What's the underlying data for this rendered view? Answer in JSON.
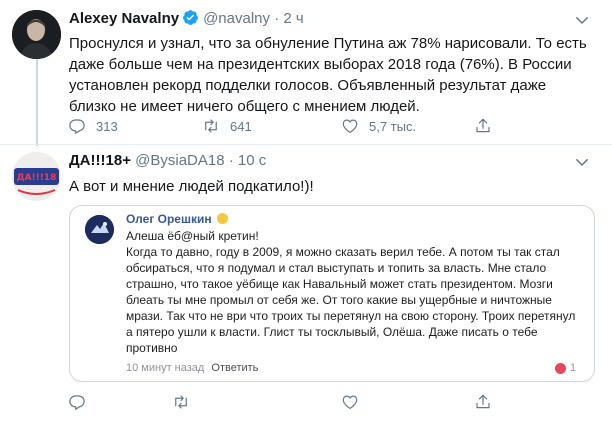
{
  "tweets": [
    {
      "author_name": "Alexey Navalny",
      "handle": "@navalny",
      "separator": "·",
      "time": "2 ч",
      "text": "Проснулся и узнал, что за обнуление Путина аж 78% нарисовали. То есть даже больше чем на президентских выборах 2018 года (76%). В России установлен рекорд подделки голосов. Объявленный результат даже близко не имеет ничего общего с мнением людей.",
      "reply_count": "313",
      "retweet_count": "641",
      "like_count": "5,7 тыс."
    },
    {
      "author_name": "ДА!!!18+",
      "handle": "@BysiaDA18",
      "separator": "·",
      "time": "10 с",
      "avatar_text": "ДА!!!18",
      "text": "А вот и мнение людей подкатило!)!",
      "quote": {
        "author_name": "Олег Орешкин",
        "text": "Алеша ёб@ный кретин!\nКогда то давно, году в 2009, я можно сказать верил тебе. А потом ты так стал обсираться, что я подумал и стал выступать и топить за власть. Мне стало страшно, что такое уёбище как Навальный может стать президентом. Мозги блеать ты мне промыл от себя же. От того какие вы ущербные и ничтожные мрази. Так что не ври что троих ты перетянул на свою сторону. Троих перетянул а пятеро ушли к власти. Глист ты тосклывый, Олёша. Даже писать о тебе противно",
        "time": "10 минут назад",
        "reply_label": "Ответить",
        "like_count": "1"
      }
    }
  ],
  "colors": {
    "accent": "#1da1f2",
    "verified": "#1da1f2",
    "secondary_text": "#657786",
    "border": "#e6ecf0",
    "quote_name": "#385898"
  },
  "icons": {
    "reply": "reply-icon",
    "retweet": "retweet-icon",
    "like": "heart-icon",
    "share": "share-icon",
    "more": "chevron-down-icon",
    "verified": "verified-badge-icon"
  }
}
